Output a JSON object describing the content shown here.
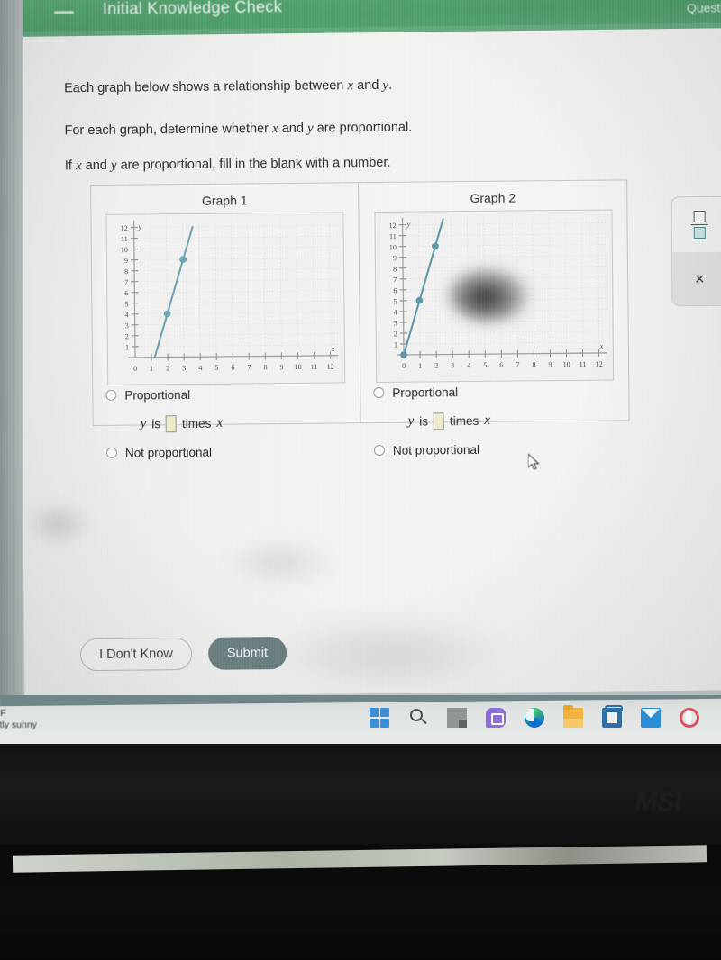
{
  "header": {
    "menu_icon": "hamburger-icon",
    "title": "Initial Knowledge Check",
    "question_label": "Question",
    "bar_color": "#4f9f6b"
  },
  "prompt": {
    "line1_a": "Each graph below shows a relationship between ",
    "line1_x": "x",
    "line1_b": " and ",
    "line1_y": "y",
    "line1_c": ".",
    "line2_a": "For each graph, determine whether ",
    "line2_x": "x",
    "line2_b": " and ",
    "line2_y": "y",
    "line2_c": " are proportional.",
    "line3_a": "If ",
    "line3_x": "x",
    "line3_b": " and ",
    "line3_y": "y",
    "line3_c": " are proportional, fill in the blank with a number."
  },
  "graphs": [
    {
      "title": "Graph 1",
      "options": {
        "proportional": "Proportional",
        "not_proportional": "Not proportional",
        "fill_prefix_y": "y",
        "fill_is": "is",
        "fill_value": "",
        "fill_times": "times",
        "fill_suffix_x": "x"
      },
      "selected": null
    },
    {
      "title": "Graph 2",
      "options": {
        "proportional": "Proportional",
        "not_proportional": "Not proportional",
        "fill_prefix_y": "y",
        "fill_is": "is",
        "fill_value": "",
        "fill_times": "times",
        "fill_suffix_x": "x"
      },
      "selected": null
    }
  ],
  "chart_data": [
    {
      "type": "line",
      "title": "Graph 1",
      "xlabel": "x",
      "ylabel": "y",
      "xlim": [
        0,
        12.5
      ],
      "ylim": [
        0,
        12.5
      ],
      "xticks": [
        0,
        1,
        2,
        3,
        4,
        5,
        6,
        7,
        8,
        9,
        10,
        11,
        12
      ],
      "yticks": [
        1,
        2,
        3,
        4,
        5,
        6,
        7,
        8,
        9,
        10,
        11,
        12
      ],
      "grid": true,
      "series": [
        {
          "name": "line1",
          "x": [
            1.2,
            3.6
          ],
          "y": [
            0,
            12
          ],
          "equation": "y = 5x - 6",
          "slope": 5,
          "intercept": -6,
          "passes_through_origin": false,
          "color": "#6fa4b5"
        }
      ],
      "points": [
        {
          "x": 2,
          "y": 4
        },
        {
          "x": 3,
          "y": 9
        }
      ],
      "point_color": "#6fa4b5"
    },
    {
      "type": "line",
      "title": "Graph 2",
      "xlabel": "x",
      "ylabel": "y",
      "xlim": [
        0,
        12.5
      ],
      "ylim": [
        0,
        12.5
      ],
      "xticks": [
        0,
        1,
        2,
        3,
        4,
        5,
        6,
        7,
        8,
        9,
        10,
        11,
        12
      ],
      "yticks": [
        1,
        2,
        3,
        4,
        5,
        6,
        7,
        8,
        9,
        10,
        11,
        12
      ],
      "grid": true,
      "series": [
        {
          "name": "line2",
          "x": [
            0,
            2.5
          ],
          "y": [
            0,
            12.5
          ],
          "equation": "y = 5x",
          "slope": 5,
          "intercept": 0,
          "passes_through_origin": true,
          "color": "#5d97a8"
        }
      ],
      "points": [
        {
          "x": 0,
          "y": 0
        },
        {
          "x": 1,
          "y": 5
        },
        {
          "x": 2,
          "y": 10
        }
      ],
      "point_color": "#5d97a8"
    }
  ],
  "toolbar": {
    "fraction_icon": "fraction-icon",
    "times_icon": "times-icon",
    "times_glyph": "×"
  },
  "buttons": {
    "dont_know": "I Don't Know",
    "submit": "Submit",
    "submit_color": "#6d8183"
  },
  "taskbar": {
    "weather_temp": "°F",
    "weather_cond": "rtly sunny",
    "icons": [
      {
        "name": "start-icon",
        "label": "Start"
      },
      {
        "name": "search-icon",
        "label": "Search"
      },
      {
        "name": "task-view-icon",
        "label": "Task View"
      },
      {
        "name": "chat-icon",
        "label": "Chat"
      },
      {
        "name": "edge-browser-icon",
        "label": "Microsoft Edge"
      },
      {
        "name": "file-explorer-icon",
        "label": "File Explorer"
      },
      {
        "name": "microsoft-store-icon",
        "label": "Microsoft Store"
      },
      {
        "name": "mail-icon",
        "label": "Mail"
      },
      {
        "name": "opera-browser-icon",
        "label": "Opera"
      }
    ]
  },
  "device": {
    "brand": "MSI"
  }
}
